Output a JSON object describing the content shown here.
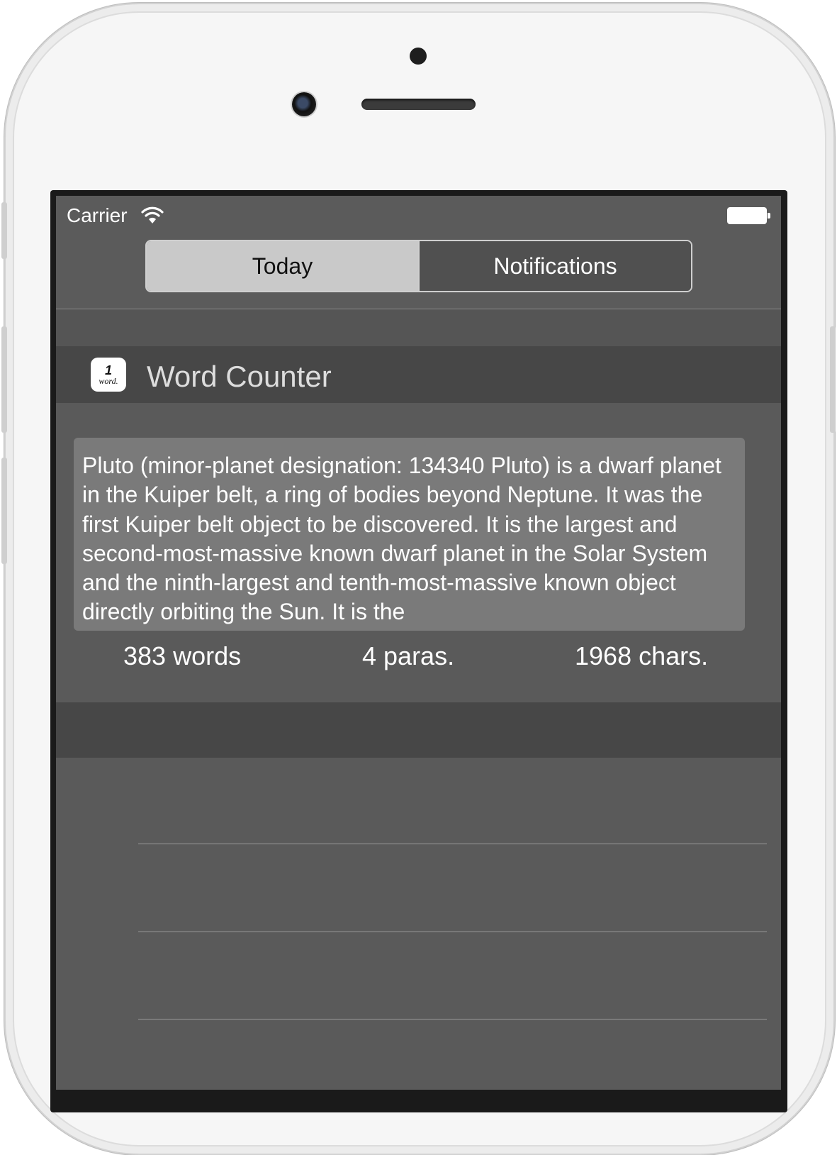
{
  "status_bar": {
    "carrier": "Carrier",
    "wifi_icon": "wifi-icon",
    "battery_icon": "battery-icon"
  },
  "segmented_control": {
    "tabs": [
      {
        "label": "Today",
        "selected": true
      },
      {
        "label": "Notifications",
        "selected": false
      }
    ]
  },
  "widget": {
    "icon": {
      "number": "1",
      "word": "word."
    },
    "title": "Word Counter",
    "text": "Pluto (minor-planet designation: 134340 Pluto) is a dwarf planet in the Kuiper belt, a ring of bodies beyond Neptune. It was the first Kuiper belt object to be discovered. It is the largest and second-most-massive known dwarf planet in the Solar System and the ninth-largest and tenth-most-massive known object directly orbiting the Sun. It is the",
    "stats": {
      "words": "383 words",
      "paragraphs": "4 paras.",
      "characters": "1968 chars."
    }
  },
  "colors": {
    "screen_background": "#5a5a5a",
    "header_band": "#474747",
    "text_box": "#7a7a7a",
    "segment_selected": "#c9c9c9"
  }
}
